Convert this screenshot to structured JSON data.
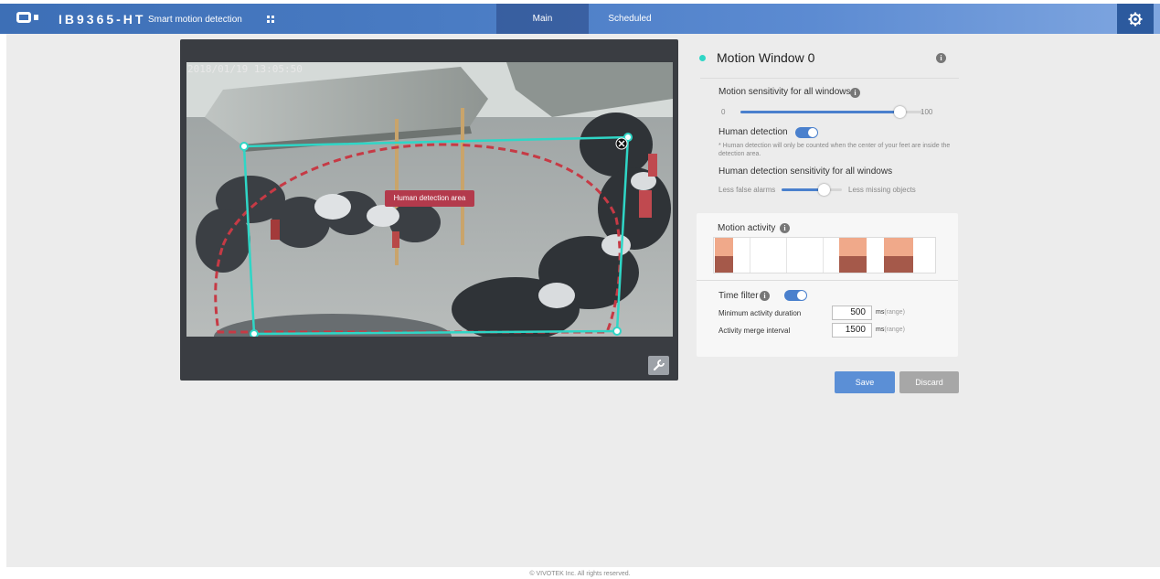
{
  "header": {
    "model": "IB9365-HT",
    "section": "Smart motion detection",
    "tabs": [
      {
        "label": "Main",
        "active": true
      },
      {
        "label": "Scheduled",
        "active": false
      }
    ],
    "colors": {
      "bar": "#4a7cc4",
      "active_tab": "#2c5a9e"
    },
    "icons": {
      "logo": "vivotek-logo-icon",
      "menu": "grid-menu-icon",
      "settings": "settings-gear-icon"
    }
  },
  "video": {
    "timestamp": "2018/01/19 13:05:50",
    "region_label": "Human detection area",
    "tool_icon": "wrench-icon"
  },
  "panel": {
    "window_title": "Motion Window 0",
    "window_color": "#2fd6c6",
    "motion_sensitivity": {
      "label": "Motion sensitivity for all windows",
      "min": "0",
      "max": "100",
      "value": 92
    },
    "human_detection": {
      "label": "Human detection",
      "enabled": true,
      "note": "* Human detection will only be counted when the center of your feet are inside the detection area."
    },
    "human_sensitivity": {
      "label": "Human detection sensitivity for all windows",
      "left_label": "Less false alarms",
      "right_label": "Less missing objects",
      "value": 75
    },
    "motion_activity": {
      "label": "Motion activity"
    },
    "time_filter": {
      "label": "Time filter",
      "enabled": true,
      "min_duration": {
        "label": "Minimum activity duration",
        "value": "500",
        "unit": "ms",
        "hint": "(range)"
      },
      "merge_interval": {
        "label": "Activity merge interval",
        "value": "1500",
        "unit": "ms",
        "hint": "(range)"
      }
    },
    "buttons": {
      "save": "Save",
      "discard": "Discard"
    }
  },
  "footer": {
    "copyright": "© VIVOTEK Inc. All rights reserved."
  }
}
